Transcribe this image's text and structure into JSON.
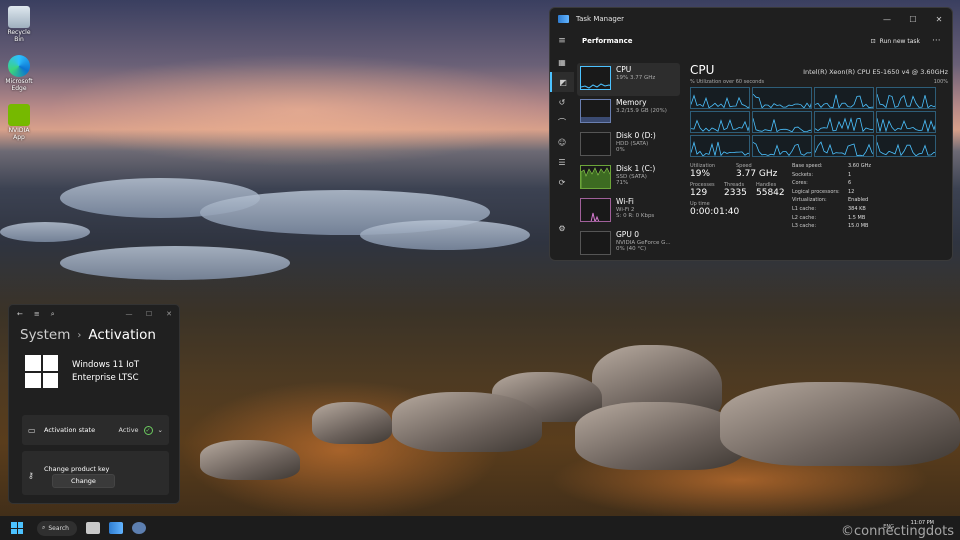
{
  "desktop": {
    "icons": [
      {
        "label": "Recycle Bin"
      },
      {
        "label": "Microsoft Edge"
      },
      {
        "label": "NVIDIA App"
      }
    ]
  },
  "task_manager": {
    "title": "Task Manager",
    "page": "Performance",
    "run_new_task": "Run new task",
    "items": [
      {
        "name": "CPU",
        "line1": "19% 3.77 GHz",
        "line2": ""
      },
      {
        "name": "Memory",
        "line1": "3.2/15.9 GB (20%)",
        "line2": ""
      },
      {
        "name": "Disk 0 (D:)",
        "line1": "HDD (SATA)",
        "line2": "0%"
      },
      {
        "name": "Disk 1 (C:)",
        "line1": "SSD (SATA)",
        "line2": "71%"
      },
      {
        "name": "Wi-Fi",
        "line1": "Wi-Fi 2",
        "line2": "S: 0 R: 0 Kbps"
      },
      {
        "name": "GPU 0",
        "line1": "NVIDIA GeForce G...",
        "line2": "0% (40 °C)"
      }
    ],
    "cpu": {
      "heading": "CPU",
      "model": "Intel(R) Xeon(R) CPU E5-1650 v4 @ 3.60GHz",
      "util_label": "% Utilization over 60 seconds",
      "util_max": "100%",
      "stats": {
        "utilization_label": "Utilization",
        "utilization": "19%",
        "speed_label": "Speed",
        "speed": "3.77 GHz",
        "processes_label": "Processes",
        "processes": "129",
        "threads_label": "Threads",
        "threads": "2335",
        "handles_label": "Handles",
        "handles": "55842",
        "uptime_label": "Up time",
        "uptime": "0:00:01:40"
      },
      "details": [
        {
          "k": "Base speed:",
          "v": "3.60 GHz"
        },
        {
          "k": "Sockets:",
          "v": "1"
        },
        {
          "k": "Cores:",
          "v": "6"
        },
        {
          "k": "Logical processors:",
          "v": "12"
        },
        {
          "k": "Virtualization:",
          "v": "Enabled"
        },
        {
          "k": "L1 cache:",
          "v": "384 KB"
        },
        {
          "k": "L2 cache:",
          "v": "1.5 MB"
        },
        {
          "k": "L3 cache:",
          "v": "15.0 MB"
        }
      ]
    }
  },
  "settings": {
    "crumb_parent": "System",
    "crumb_current": "Activation",
    "product_line1": "Windows 11 IoT",
    "product_line2": "Enterprise LTSC",
    "activation_state_label": "Activation state",
    "activation_state_value": "Active",
    "change_key_label": "Change product key",
    "change_button": "Change"
  },
  "taskbar": {
    "search": "Search",
    "time": "11:07 PM",
    "tray": "ENG"
  },
  "watermark": "©connectingdots",
  "colors": {
    "accent": "#4cc2ff",
    "active_green": "#6ccb5f",
    "graph_line": "#4cc2ff"
  }
}
